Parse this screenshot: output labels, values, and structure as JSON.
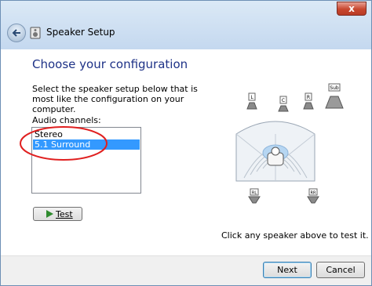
{
  "window": {
    "title": "Speaker Setup",
    "close_label": "x"
  },
  "page": {
    "heading": "Choose your configuration",
    "description": "Select the speaker setup below that is most like the configuration on your computer.",
    "channels_label": "Audio channels:",
    "channels": [
      "Stereo",
      "5.1 Surround"
    ],
    "selected_channel": "5.1 Surround",
    "test_button": "Test",
    "hint": "Click any speaker above to test it."
  },
  "speakers": {
    "left": "L",
    "center": "C",
    "right": "R",
    "sub": "Sub",
    "rear_left": "RL",
    "rear_right": "RR"
  },
  "footer": {
    "next": "Next",
    "cancel": "Cancel"
  },
  "annotation": {
    "color": "#e02020"
  }
}
